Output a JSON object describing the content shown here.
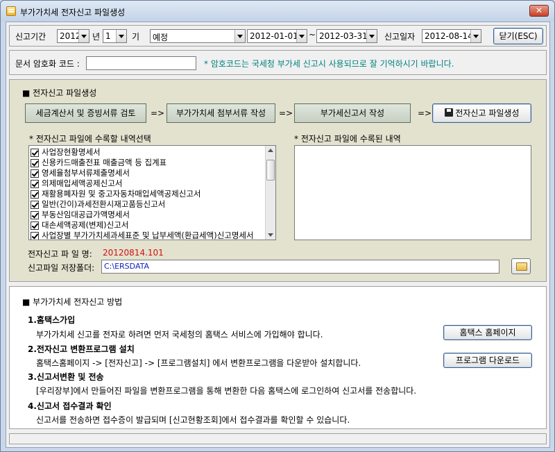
{
  "window": {
    "title": "부가가치세 전자신고 파일생성"
  },
  "period": {
    "label": "신고기간",
    "year": "2012",
    "year_unit": "년",
    "term": "1",
    "term_unit": "기",
    "type": "예정",
    "start_date": "2012-01-01",
    "tilde": "~",
    "end_date": "2012-03-31",
    "filing_date_label": "신고일자",
    "filing_date": "2012-08-14",
    "close_label": "닫기(ESC)"
  },
  "password": {
    "label": "문서 암호화 코드 :",
    "value": "",
    "hint": "* 암호코드는 국세청 부가세 신고시 사용되므로 잘 기억하시기 바랍니다."
  },
  "create": {
    "section_title": "■ 전자신고 파일생성",
    "steps": [
      "세금계산서 및 증빙서류 검토",
      "부가가치세 첨부서류 작성",
      "부가세신고서 작성"
    ],
    "arrow": "=>",
    "create_button": "전자신고 파일생성",
    "select_label": "* 전자신고 파일에 수록할 내역선택",
    "recorded_label": "* 전자신고 파일에 수록된 내역",
    "items": [
      "사업장현황명세서",
      "신용카드매출전표 매출금액 등 집계표",
      "영세율첨부서류제출명세서",
      "의제매입세액공제신고서",
      "재활용폐자원 및 중고자동차매입세액공제신고서",
      "일반(간이)과세전환시재고품등신고서",
      "부동산임대공급가액명세서",
      "대손세액공제(변제)신고서",
      "사업장별 부가가치세과세표준 및 납부세액(환급세액)신고명세서"
    ],
    "filename_label": "전자신고 파 일 명:",
    "filename": "20120814.101",
    "folder_label": "신고파일 저장폴더:",
    "folder": "C:\\ERSDATA"
  },
  "howto": {
    "section_title": "■ 부가가치세 전자신고 방법",
    "steps": [
      {
        "title": "1.홈택스가입",
        "desc": "부가가치세 신고를 전자로 하려면 먼저 국세청의 홈택스 서비스에 가입해야 합니다.",
        "button": "홈택스 홈페이지"
      },
      {
        "title": "2.전자신고 변환프로그램 설치",
        "desc": "홈택스홈페이지 -> [전자신고] -> [프로그램설치] 에서 변환프로그램을 다운받아 설치합니다.",
        "button": "프로그램 다운로드"
      },
      {
        "title": "3.신고서변환 및 전송",
        "desc": "[우리장부]에서 만들어진 파일을 변환프로그램을 통해 변환한 다음 홈택스에 로그인하여 신고서를 전송합니다."
      },
      {
        "title": "4.신고서 접수결과 확인",
        "desc": "신고서를 전송하면 접수증이 발급되며 [신고현황조회]에서 접수결과를 확인할 수 있습니다."
      }
    ]
  },
  "colors": {
    "title_bg": "#c9d7ea",
    "create_panel_bg": "#e3e2cf",
    "hint": "#008080",
    "filename": "#d01010",
    "folder": "#1020c0"
  },
  "icons": [
    "app-icon",
    "close-icon",
    "save-disk-icon",
    "folder-open-icon",
    "combo-arrow-icon"
  ]
}
